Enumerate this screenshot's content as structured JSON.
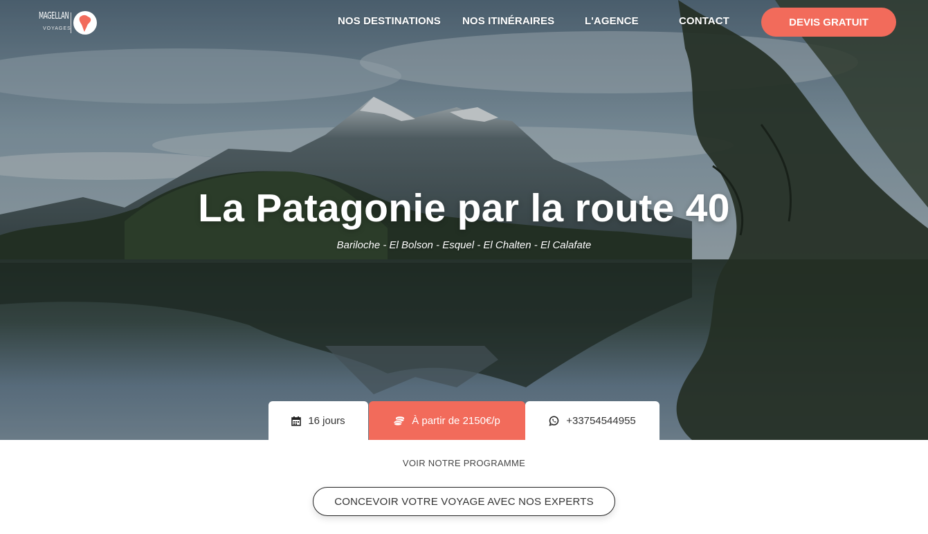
{
  "logo": {
    "name": "MAGELLAN",
    "sub": "VOYAGES",
    "icon": "south-america-map-icon"
  },
  "nav": {
    "destinations": "NOS DESTINATIONS",
    "itineraires": "NOS ITINÉRAIRES",
    "agence": "L'AGENCE",
    "contact": "CONTACT",
    "devis": "DEVIS GRATUIT"
  },
  "hero": {
    "title": "La Patagonie par la route 40",
    "subtitle": "Bariloche - El Bolson - Esquel - El Chalten - El Calafate"
  },
  "info": {
    "duration": "16 jours",
    "duration_icon": "calendar-icon",
    "price": "À partir de 2150€/p",
    "price_icon": "coins-icon",
    "phone": "+33754544955",
    "phone_icon": "whatsapp-icon"
  },
  "actions": {
    "programme": "VOIR NOTRE PROGRAMME",
    "concevoir": "CONCEVOIR VOTRE VOYAGE AVEC NOS EXPERTS"
  },
  "colors": {
    "accent": "#f26b5b",
    "white": "#ffffff",
    "text": "#333333"
  }
}
